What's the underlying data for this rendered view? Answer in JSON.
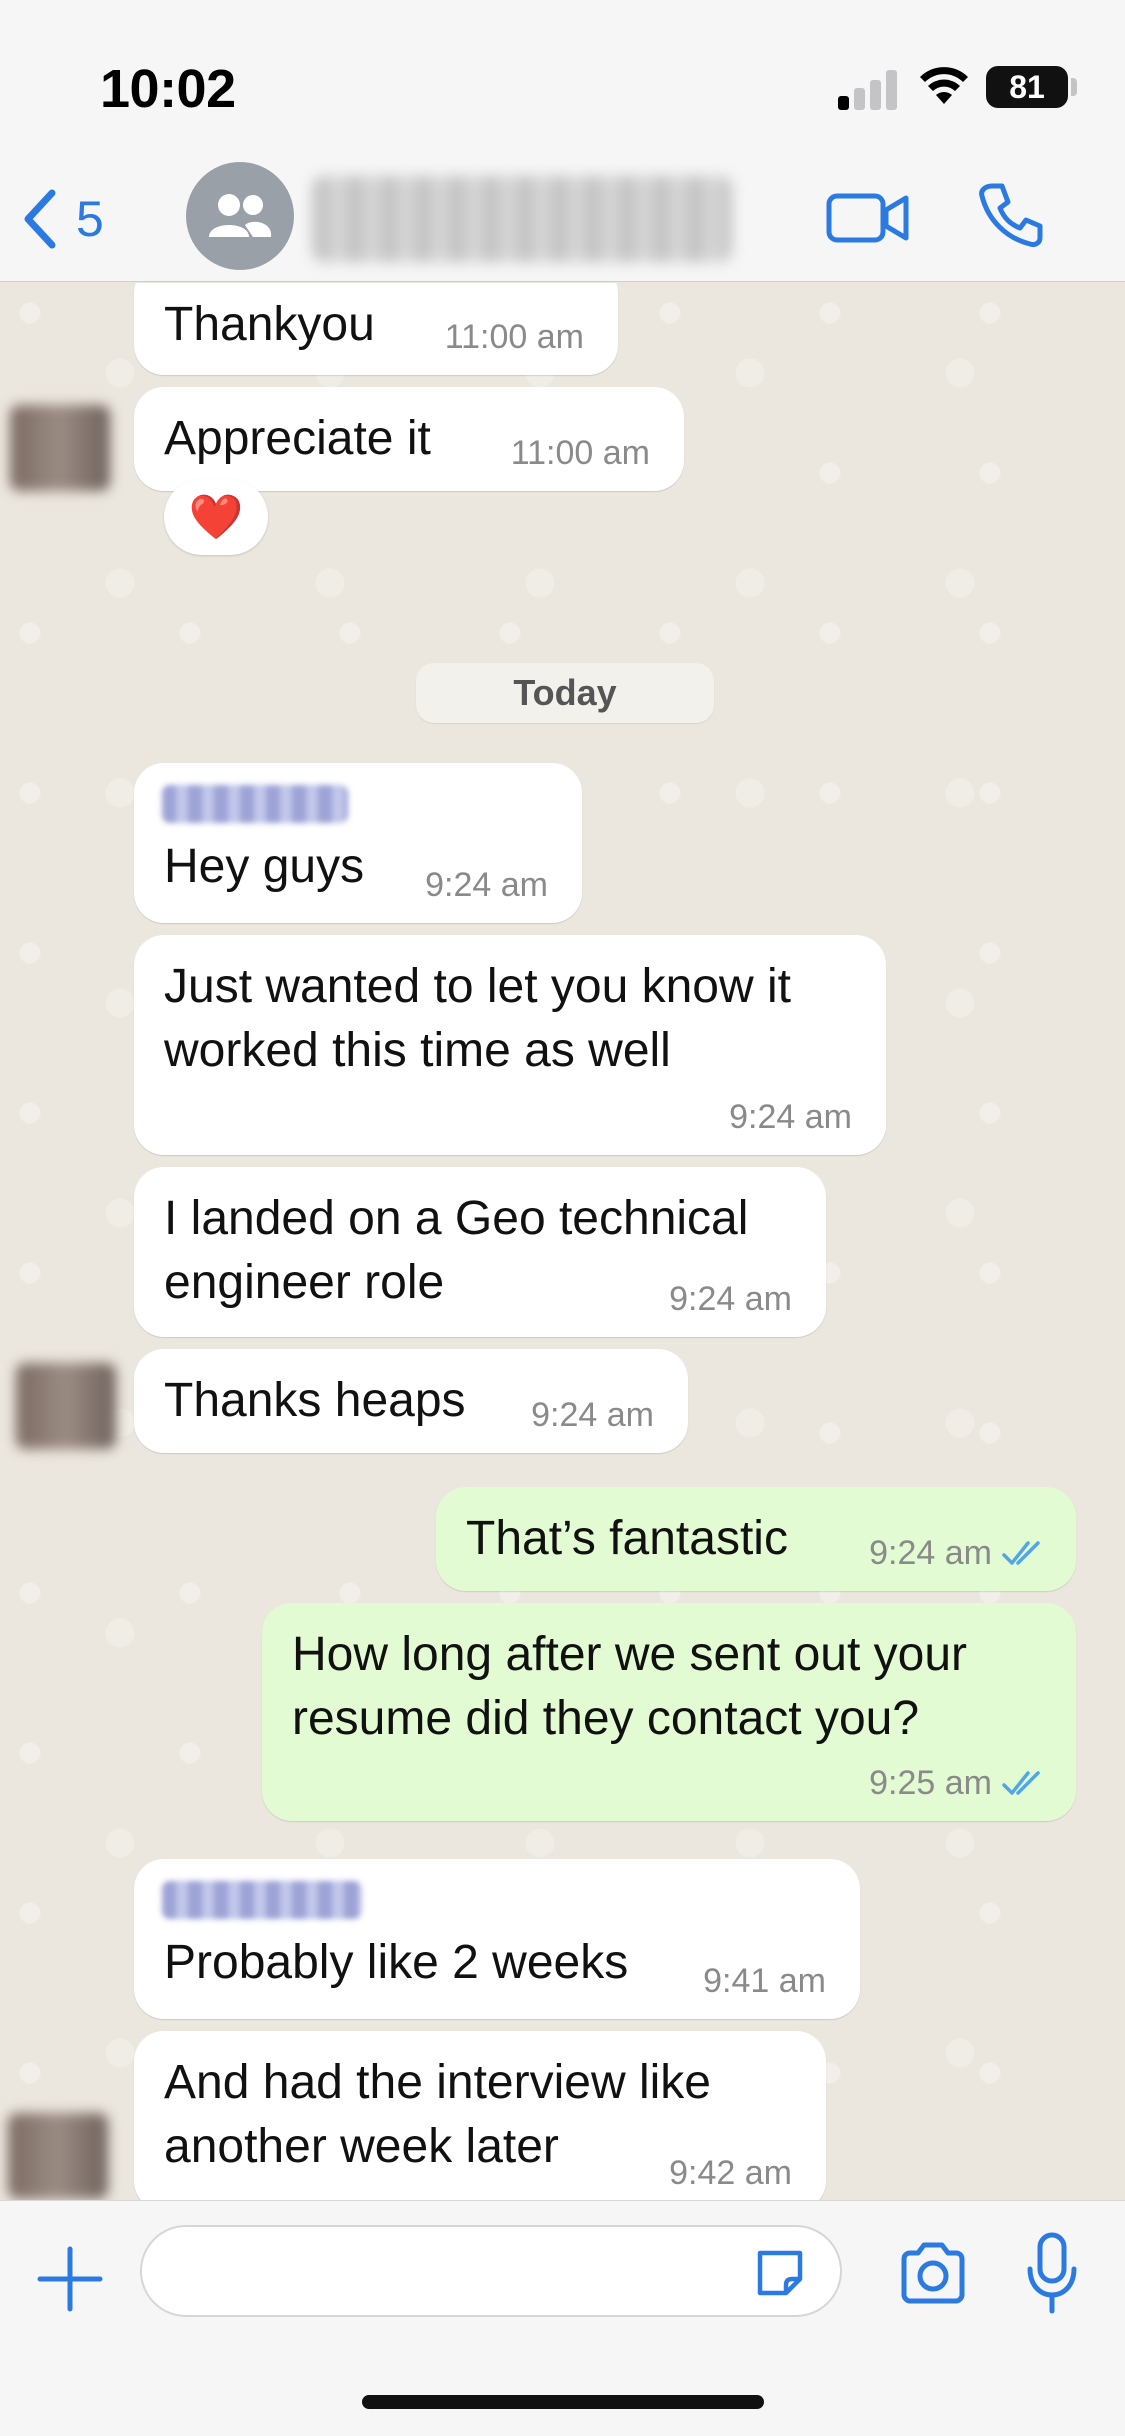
{
  "status_bar": {
    "time": "10:02",
    "battery": "81"
  },
  "header": {
    "back_count": "5"
  },
  "date_divider": "Today",
  "messages": [
    {
      "text": "Thankyou",
      "time": "11:00 am"
    },
    {
      "text": "Appreciate it",
      "time": "11:00 am",
      "reaction": "❤️"
    },
    {
      "text": "Hey guys",
      "time": "9:24 am"
    },
    {
      "text": "Just wanted to let you know it worked this time as well",
      "time": "9:24 am"
    },
    {
      "text": "I landed on a Geo technical engineer role",
      "time": "9:24 am"
    },
    {
      "text": "Thanks heaps",
      "time": "9:24 am"
    },
    {
      "text": "That’s fantastic",
      "time": "9:24 am"
    },
    {
      "text": "How long after we sent out your resume did they contact you?",
      "time": "9:25 am"
    },
    {
      "text": "Probably like 2 weeks",
      "time": "9:41 am"
    },
    {
      "text": "And had the interview like another week later",
      "time": "9:42 am"
    }
  ],
  "composer": {
    "placeholder": ""
  },
  "colors": {
    "accent": "#2a7ae2",
    "outgoing_bubble": "#e2fbd2",
    "read_ticks": "#53a6e6"
  }
}
